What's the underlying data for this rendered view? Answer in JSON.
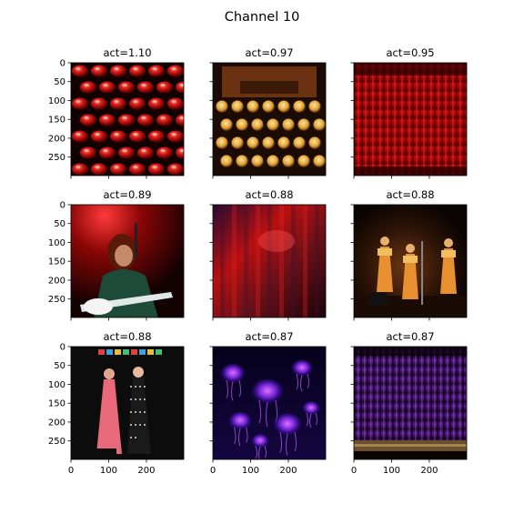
{
  "figure": {
    "title": "Channel 10"
  },
  "chart_data": {
    "type": "image_grid",
    "rows": 3,
    "cols": 3,
    "panels": [
      {
        "title": "act=1.10",
        "activation": 1.1,
        "content": "red-typewriter-keys",
        "colors": [
          "#1a0000",
          "#8c0a0a",
          "#e0413a"
        ]
      },
      {
        "title": "act=0.97",
        "activation": 0.97,
        "content": "vintage-typewriter",
        "colors": [
          "#1c0d04",
          "#6e3512",
          "#d9a43c"
        ]
      },
      {
        "title": "act=0.95",
        "activation": 0.95,
        "content": "red-stage-curtain",
        "colors": [
          "#2a0000",
          "#a00000",
          "#e81c1c"
        ]
      },
      {
        "title": "act=0.89",
        "activation": 0.89,
        "content": "guitarist-red-light",
        "colors": [
          "#0b0404",
          "#7a0808",
          "#2e6e4e"
        ]
      },
      {
        "title": "act=0.88",
        "activation": 0.88,
        "content": "blurred-red-stage",
        "colors": [
          "#1a0606",
          "#b01010",
          "#3a1a6a"
        ]
      },
      {
        "title": "act=0.88",
        "activation": 0.88,
        "content": "performers-on-stage",
        "colors": [
          "#100805",
          "#5a2a10",
          "#e0902a"
        ]
      },
      {
        "title": "act=0.88",
        "activation": 0.88,
        "content": "two-women-party",
        "colors": [
          "#0a0a0a",
          "#202020",
          "#e06a7a"
        ]
      },
      {
        "title": "act=0.87",
        "activation": 0.87,
        "content": "jellyfish-purple",
        "colors": [
          "#05021a",
          "#3a0aa0",
          "#d04adc"
        ]
      },
      {
        "title": "act=0.87",
        "activation": 0.87,
        "content": "purple-stage-curtain",
        "colors": [
          "#0a0212",
          "#3c0a60",
          "#8a3ab0"
        ]
      }
    ],
    "x_ticks": [
      0,
      100,
      200
    ],
    "y_ticks": [
      0,
      50,
      100,
      150,
      200,
      250
    ],
    "x_range": [
      0,
      299
    ],
    "y_range": [
      0,
      299
    ],
    "tick_labels_x_on": "bottom-row",
    "tick_labels_y_on": "left-column"
  }
}
